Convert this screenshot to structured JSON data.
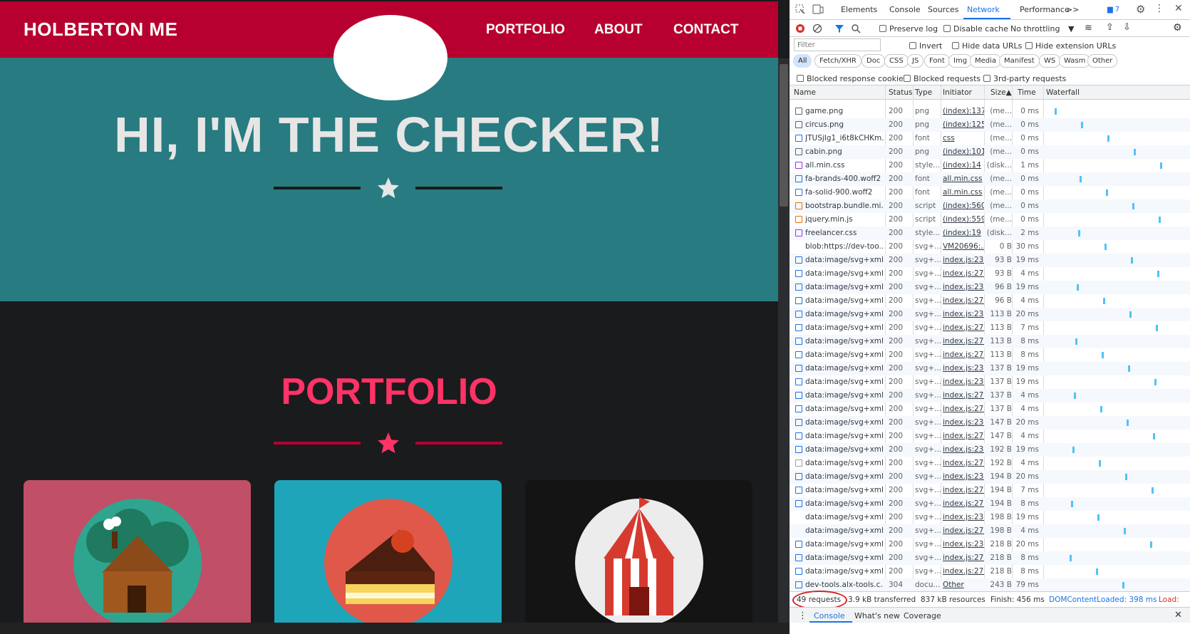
{
  "site": {
    "brand": "HOLBERTON ME",
    "nav": [
      "PORTFOLIO",
      "ABOUT",
      "CONTACT"
    ],
    "hero_title": "HI, I'M THE CHECKER!",
    "portfolio_title": "PORTFOLIO",
    "colors": {
      "nav": "#b7002f",
      "masthead": "#287b80",
      "accent": "#ff3366",
      "page": "#1a1b1d"
    },
    "cards": [
      {
        "name": "cabin",
        "bg": "#c04f67",
        "icon": "cabin-illustration"
      },
      {
        "name": "cake",
        "bg": "#1fa5ba",
        "icon": "cake-illustration"
      },
      {
        "name": "circus",
        "bg": "#141414",
        "icon": "circus-tent-illustration"
      }
    ]
  },
  "devtools": {
    "tabs": [
      "Elements",
      "Console",
      "Sources",
      "Network",
      "Performance",
      ">>"
    ],
    "active_tab": "Network",
    "issues_badge": "7",
    "toolbar": {
      "preserve_log": "Preserve log",
      "disable_cache": "Disable cache",
      "throttling": "No throttling"
    },
    "filter": {
      "placeholder": "Filter",
      "invert": "Invert",
      "hide_data_urls": "Hide data URLs",
      "hide_extension_urls": "Hide extension URLs"
    },
    "type_filters": [
      "All",
      "Fetch/XHR",
      "Doc",
      "CSS",
      "JS",
      "Font",
      "Img",
      "Media",
      "Manifest",
      "WS",
      "Wasm",
      "Other"
    ],
    "blocked_options": [
      "Blocked response cookies",
      "Blocked requests",
      "3rd-party requests"
    ],
    "columns": [
      "Name",
      "Status",
      "Type",
      "Initiator",
      "Size",
      "Time",
      "Waterfall"
    ],
    "rows": [
      {
        "name": "game.png",
        "status": "200",
        "type": "png",
        "initiator": "(index):137",
        "size": "(me...",
        "time": "0 ms",
        "icon": "image-icon"
      },
      {
        "name": "circus.png",
        "status": "200",
        "type": "png",
        "initiator": "(index):125",
        "size": "(me...",
        "time": "0 ms",
        "icon": "image-icon"
      },
      {
        "name": "JTUSjIg1_i6t8kCHKm...",
        "status": "200",
        "type": "font",
        "initiator": "css",
        "size": "(me...",
        "time": "0 ms",
        "icon": "font-icon"
      },
      {
        "name": "cabin.png",
        "status": "200",
        "type": "png",
        "initiator": "(index):101",
        "size": "(me...",
        "time": "0 ms",
        "icon": "image-icon"
      },
      {
        "name": "all.min.css",
        "status": "200",
        "type": "style...",
        "initiator": "(index):14",
        "size": "(disk...",
        "time": "1 ms",
        "icon": "css-icon"
      },
      {
        "name": "fa-brands-400.woff2",
        "status": "200",
        "type": "font",
        "initiator": "all.min.css",
        "size": "(me...",
        "time": "0 ms",
        "icon": "font-icon"
      },
      {
        "name": "fa-solid-900.woff2",
        "status": "200",
        "type": "font",
        "initiator": "all.min.css",
        "size": "(me...",
        "time": "0 ms",
        "icon": "font-icon"
      },
      {
        "name": "bootstrap.bundle.mi...",
        "status": "200",
        "type": "script",
        "initiator": "(index):560",
        "size": "(me...",
        "time": "0 ms",
        "icon": "script-icon"
      },
      {
        "name": "jquery.min.js",
        "status": "200",
        "type": "script",
        "initiator": "(index):559",
        "size": "(me...",
        "time": "0 ms",
        "icon": "script-icon"
      },
      {
        "name": "freelancer.css",
        "status": "200",
        "type": "style...",
        "initiator": "(index):19",
        "size": "(disk...",
        "time": "2 ms",
        "icon": "css-icon"
      },
      {
        "name": "blob:https://dev-too...",
        "status": "200",
        "type": "svg+...",
        "initiator": "VM20696:...",
        "size": "0 B",
        "time": "30 ms",
        "icon": "blank-icon"
      },
      {
        "name": "data:image/svg+xml...",
        "status": "200",
        "type": "svg+...",
        "initiator": "index.js:23...",
        "size": "93 B",
        "time": "19 ms",
        "icon": "doc-icon"
      },
      {
        "name": "data:image/svg+xml...",
        "status": "200",
        "type": "svg+...",
        "initiator": "index.js:27...",
        "size": "93 B",
        "time": "4 ms",
        "icon": "doc-icon"
      },
      {
        "name": "data:image/svg+xml...",
        "status": "200",
        "type": "svg+...",
        "initiator": "index.js:23...",
        "size": "96 B",
        "time": "19 ms",
        "icon": "doc-icon"
      },
      {
        "name": "data:image/svg+xml...",
        "status": "200",
        "type": "svg+...",
        "initiator": "index.js:27...",
        "size": "96 B",
        "time": "4 ms",
        "icon": "doc-icon"
      },
      {
        "name": "data:image/svg+xml...",
        "status": "200",
        "type": "svg+...",
        "initiator": "index.js:23...",
        "size": "113 B",
        "time": "20 ms",
        "icon": "doc-icon"
      },
      {
        "name": "data:image/svg+xml...",
        "status": "200",
        "type": "svg+...",
        "initiator": "index.js:27...",
        "size": "113 B",
        "time": "7 ms",
        "icon": "doc-icon"
      },
      {
        "name": "data:image/svg+xml...",
        "status": "200",
        "type": "svg+...",
        "initiator": "index.js:27...",
        "size": "113 B",
        "time": "8 ms",
        "icon": "doc-icon"
      },
      {
        "name": "data:image/svg+xml...",
        "status": "200",
        "type": "svg+...",
        "initiator": "index.js:27...",
        "size": "113 B",
        "time": "8 ms",
        "icon": "doc-icon"
      },
      {
        "name": "data:image/svg+xml...",
        "status": "200",
        "type": "svg+...",
        "initiator": "index.js:23...",
        "size": "137 B",
        "time": "19 ms",
        "icon": "doc-icon"
      },
      {
        "name": "data:image/svg+xml...",
        "status": "200",
        "type": "svg+...",
        "initiator": "index.js:23...",
        "size": "137 B",
        "time": "19 ms",
        "icon": "doc-icon"
      },
      {
        "name": "data:image/svg+xml...",
        "status": "200",
        "type": "svg+...",
        "initiator": "index.js:27...",
        "size": "137 B",
        "time": "4 ms",
        "icon": "doc-icon"
      },
      {
        "name": "data:image/svg+xml...",
        "status": "200",
        "type": "svg+...",
        "initiator": "index.js:27...",
        "size": "137 B",
        "time": "4 ms",
        "icon": "doc-icon"
      },
      {
        "name": "data:image/svg+xml...",
        "status": "200",
        "type": "svg+...",
        "initiator": "index.js:23...",
        "size": "147 B",
        "time": "20 ms",
        "icon": "doc-icon"
      },
      {
        "name": "data:image/svg+xml...",
        "status": "200",
        "type": "svg+...",
        "initiator": "index.js:27...",
        "size": "147 B",
        "time": "4 ms",
        "icon": "doc-icon"
      },
      {
        "name": "data:image/svg+xml...",
        "status": "200",
        "type": "svg+...",
        "initiator": "index.js:23...",
        "size": "192 B",
        "time": "19 ms",
        "icon": "doc-icon"
      },
      {
        "name": "data:image/svg+xml...",
        "status": "200",
        "type": "svg+...",
        "initiator": "index.js:27...",
        "size": "192 B",
        "time": "4 ms",
        "icon": "lines-icon"
      },
      {
        "name": "data:image/svg+xml...",
        "status": "200",
        "type": "svg+...",
        "initiator": "index.js:23...",
        "size": "194 B",
        "time": "20 ms",
        "icon": "doc-icon"
      },
      {
        "name": "data:image/svg+xml...",
        "status": "200",
        "type": "svg+...",
        "initiator": "index.js:27...",
        "size": "194 B",
        "time": "7 ms",
        "icon": "doc-icon"
      },
      {
        "name": "data:image/svg+xml...",
        "status": "200",
        "type": "svg+...",
        "initiator": "index.js:27...",
        "size": "194 B",
        "time": "8 ms",
        "icon": "doc-icon"
      },
      {
        "name": "data:image/svg+xml...",
        "status": "200",
        "type": "svg+...",
        "initiator": "index.js:23...",
        "size": "198 B",
        "time": "19 ms",
        "icon": "blank-icon"
      },
      {
        "name": "data:image/svg+xml...",
        "status": "200",
        "type": "svg+...",
        "initiator": "index.js:27...",
        "size": "198 B",
        "time": "4 ms",
        "icon": "blank-icon"
      },
      {
        "name": "data:image/svg+xml...",
        "status": "200",
        "type": "svg+...",
        "initiator": "index.js:23...",
        "size": "218 B",
        "time": "20 ms",
        "icon": "doc-icon"
      },
      {
        "name": "data:image/svg+xml...",
        "status": "200",
        "type": "svg+...",
        "initiator": "index.js:27...",
        "size": "218 B",
        "time": "8 ms",
        "icon": "doc-icon"
      },
      {
        "name": "data:image/svg+xml...",
        "status": "200",
        "type": "svg+...",
        "initiator": "index.js:27...",
        "size": "218 B",
        "time": "8 ms",
        "icon": "doc-icon"
      },
      {
        "name": "dev-tools.alx-tools.c...",
        "status": "304",
        "type": "docu...",
        "initiator": "Other",
        "size": "243 B",
        "time": "79 ms",
        "icon": "doc-icon"
      }
    ],
    "status_bar": {
      "requests": "49 requests",
      "transferred": "3.9 kB transferred",
      "resources": "837 kB resources",
      "finish": "Finish: 456 ms",
      "dcl": "DOMContentLoaded: 398 ms",
      "load": "Load:"
    },
    "drawer_tabs": [
      "Console",
      "What's new",
      "Coverage"
    ]
  }
}
